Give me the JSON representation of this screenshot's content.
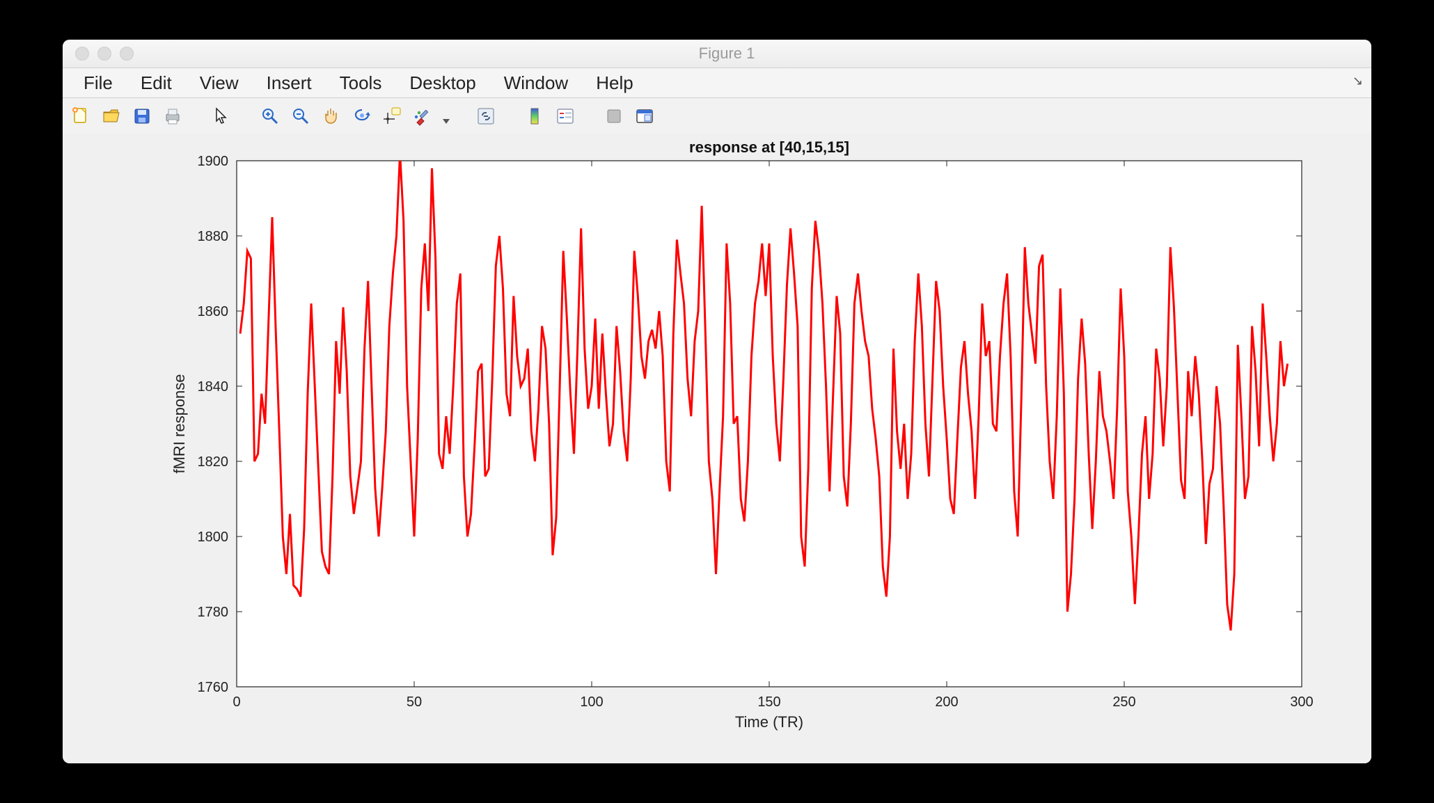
{
  "window": {
    "title": "Figure 1"
  },
  "menu": {
    "items": [
      "File",
      "Edit",
      "View",
      "Insert",
      "Tools",
      "Desktop",
      "Window",
      "Help"
    ]
  },
  "toolbar": {
    "buttons": [
      "new-figure",
      "open",
      "save",
      "print",
      "sep",
      "pointer",
      "sep",
      "zoom-in",
      "zoom-out",
      "pan",
      "rotate3d",
      "data-cursor",
      "brush",
      "dropdown",
      "sep",
      "link",
      "sep",
      "colorbar",
      "legend",
      "sep",
      "hide-tools",
      "dock"
    ]
  },
  "chart_data": {
    "type": "line",
    "title": "response at [40,15,15]",
    "xlabel": "Time (TR)",
    "ylabel": "fMRI response",
    "xlim": [
      0,
      300
    ],
    "ylim": [
      1760,
      1900
    ],
    "xticks": [
      0,
      50,
      100,
      150,
      200,
      250,
      300
    ],
    "yticks": [
      1760,
      1780,
      1800,
      1820,
      1840,
      1860,
      1880,
      1900
    ],
    "color": "#ff0000",
    "x": [
      1,
      2,
      3,
      4,
      5,
      6,
      7,
      8,
      9,
      10,
      11,
      12,
      13,
      14,
      15,
      16,
      17,
      18,
      19,
      20,
      21,
      22,
      23,
      24,
      25,
      26,
      27,
      28,
      29,
      30,
      31,
      32,
      33,
      34,
      35,
      36,
      37,
      38,
      39,
      40,
      41,
      42,
      43,
      44,
      45,
      46,
      47,
      48,
      49,
      50,
      51,
      52,
      53,
      54,
      55,
      56,
      57,
      58,
      59,
      60,
      61,
      62,
      63,
      64,
      65,
      66,
      67,
      68,
      69,
      70,
      71,
      72,
      73,
      74,
      75,
      76,
      77,
      78,
      79,
      80,
      81,
      82,
      83,
      84,
      85,
      86,
      87,
      88,
      89,
      90,
      91,
      92,
      93,
      94,
      95,
      96,
      97,
      98,
      99,
      100,
      101,
      102,
      103,
      104,
      105,
      106,
      107,
      108,
      109,
      110,
      111,
      112,
      113,
      114,
      115,
      116,
      117,
      118,
      119,
      120,
      121,
      122,
      123,
      124,
      125,
      126,
      127,
      128,
      129,
      130,
      131,
      132,
      133,
      134,
      135,
      136,
      137,
      138,
      139,
      140,
      141,
      142,
      143,
      144,
      145,
      146,
      147,
      148,
      149,
      150,
      151,
      152,
      153,
      154,
      155,
      156,
      157,
      158,
      159,
      160,
      161,
      162,
      163,
      164,
      165,
      166,
      167,
      168,
      169,
      170,
      171,
      172,
      173,
      174,
      175,
      176,
      177,
      178,
      179,
      180,
      181,
      182,
      183,
      184,
      185,
      186,
      187,
      188,
      189,
      190,
      191,
      192,
      193,
      194,
      195,
      196,
      197,
      198,
      199,
      200,
      201,
      202,
      203,
      204,
      205,
      206,
      207,
      208,
      209,
      210,
      211,
      212,
      213,
      214,
      215,
      216,
      217,
      218,
      219,
      220,
      221,
      222,
      223,
      224,
      225,
      226,
      227,
      228,
      229,
      230,
      231,
      232,
      233,
      234,
      235,
      236,
      237,
      238,
      239,
      240,
      241,
      242,
      243,
      244,
      245,
      246,
      247,
      248,
      249,
      250,
      251,
      252,
      253,
      254,
      255,
      256,
      257,
      258,
      259,
      260,
      261,
      262,
      263,
      264,
      265,
      266,
      267,
      268,
      269,
      270,
      271,
      272,
      273,
      274,
      275,
      276,
      277,
      278,
      279,
      280,
      281,
      282,
      283,
      284,
      285,
      286,
      287,
      288,
      289,
      290,
      291,
      292,
      293,
      294,
      295,
      296
    ],
    "y": [
      1854,
      1862,
      1876,
      1874,
      1820,
      1822,
      1838,
      1830,
      1858,
      1885,
      1855,
      1828,
      1800,
      1790,
      1806,
      1787,
      1786,
      1784,
      1802,
      1838,
      1862,
      1840,
      1818,
      1796,
      1792,
      1790,
      1816,
      1852,
      1838,
      1861,
      1844,
      1816,
      1806,
      1813,
      1820,
      1850,
      1868,
      1840,
      1813,
      1800,
      1813,
      1828,
      1856,
      1870,
      1880,
      1902,
      1884,
      1840,
      1820,
      1800,
      1826,
      1866,
      1878,
      1860,
      1898,
      1874,
      1822,
      1818,
      1832,
      1822,
      1840,
      1862,
      1870,
      1816,
      1800,
      1806,
      1824,
      1844,
      1846,
      1816,
      1818,
      1842,
      1872,
      1880,
      1866,
      1838,
      1832,
      1864,
      1848,
      1840,
      1842,
      1850,
      1828,
      1820,
      1834,
      1856,
      1850,
      1830,
      1795,
      1805,
      1840,
      1876,
      1858,
      1838,
      1822,
      1850,
      1882,
      1850,
      1834,
      1840,
      1858,
      1834,
      1854,
      1838,
      1824,
      1830,
      1856,
      1844,
      1828,
      1820,
      1842,
      1876,
      1864,
      1848,
      1842,
      1852,
      1855,
      1850,
      1860,
      1848,
      1820,
      1812,
      1854,
      1879,
      1870,
      1862,
      1842,
      1832,
      1852,
      1860,
      1888,
      1855,
      1820,
      1810,
      1790,
      1812,
      1832,
      1878,
      1862,
      1830,
      1832,
      1810,
      1804,
      1820,
      1848,
      1862,
      1868,
      1878,
      1864,
      1878,
      1848,
      1830,
      1820,
      1842,
      1867,
      1882,
      1870,
      1856,
      1800,
      1792,
      1818,
      1866,
      1884,
      1876,
      1862,
      1840,
      1812,
      1838,
      1864,
      1854,
      1816,
      1808,
      1830,
      1862,
      1870,
      1860,
      1852,
      1848,
      1834,
      1826,
      1816,
      1792,
      1784,
      1800,
      1850,
      1828,
      1818,
      1830,
      1810,
      1822,
      1852,
      1870,
      1856,
      1830,
      1816,
      1842,
      1868,
      1860,
      1840,
      1826,
      1810,
      1806,
      1826,
      1845,
      1852,
      1838,
      1828,
      1810,
      1832,
      1862,
      1848,
      1852,
      1830,
      1828,
      1848,
      1862,
      1870,
      1848,
      1812,
      1800,
      1836,
      1877,
      1862,
      1854,
      1846,
      1872,
      1875,
      1840,
      1820,
      1810,
      1832,
      1866,
      1838,
      1780,
      1790,
      1810,
      1842,
      1858,
      1846,
      1822,
      1802,
      1820,
      1844,
      1832,
      1828,
      1820,
      1810,
      1834,
      1866,
      1848,
      1812,
      1800,
      1782,
      1800,
      1822,
      1832,
      1810,
      1822,
      1850,
      1842,
      1824,
      1840,
      1877,
      1861,
      1838,
      1815,
      1810,
      1844,
      1832,
      1848,
      1838,
      1820,
      1798,
      1814,
      1818,
      1840,
      1830,
      1808,
      1782,
      1775,
      1790,
      1851,
      1832,
      1810,
      1816,
      1856,
      1844,
      1824,
      1862,
      1848,
      1832,
      1820,
      1830,
      1852,
      1840,
      1846
    ]
  }
}
